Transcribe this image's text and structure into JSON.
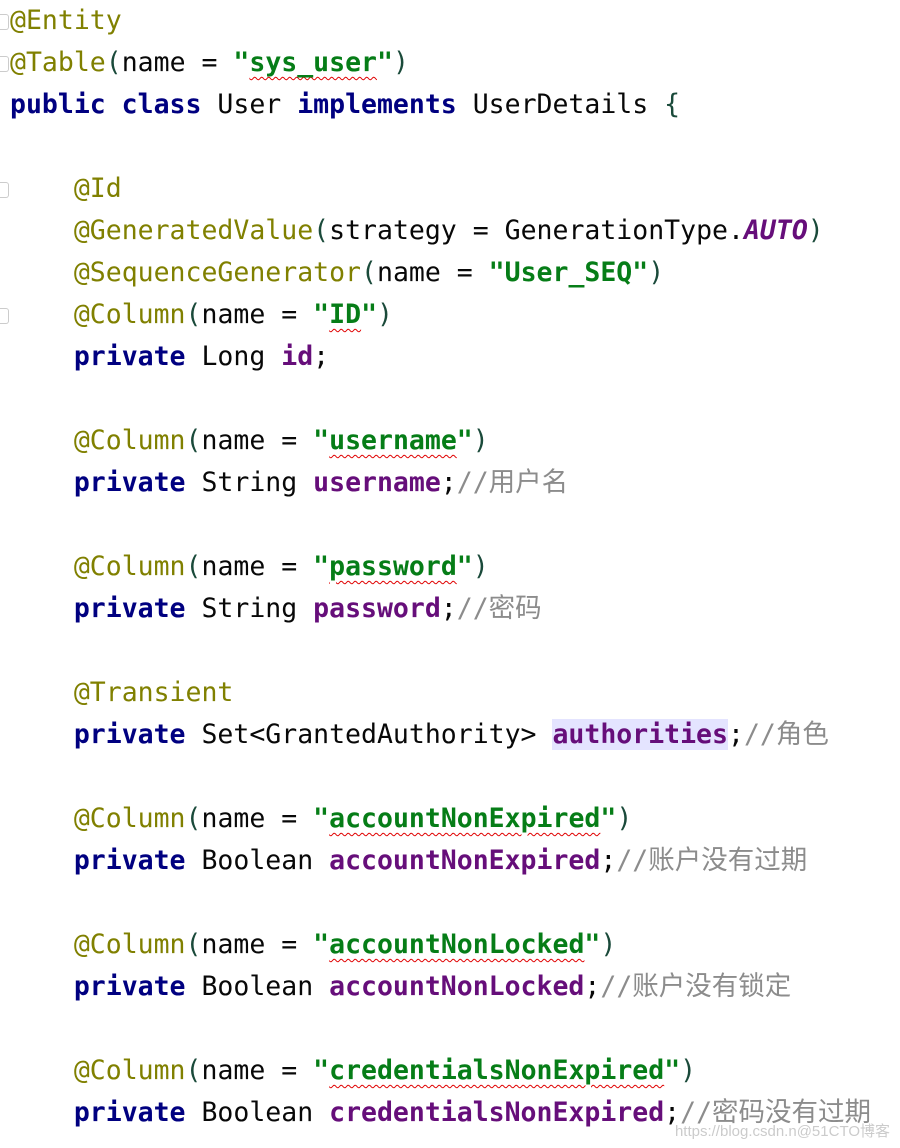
{
  "colors": {
    "annotation": "#808000",
    "keyword": "#000080",
    "string": "#067d17",
    "field": "#660e7a",
    "comment": "#8c8c8c",
    "highlight": "#e4e4ff"
  },
  "lines": [
    [
      [
        "ann",
        "@Entity"
      ]
    ],
    [
      [
        "ann",
        "@Table"
      ],
      [
        "paren",
        "("
      ],
      [
        "plain",
        "name = "
      ],
      [
        "str",
        "\""
      ],
      [
        "str sq",
        "sys_user"
      ],
      [
        "str",
        "\""
      ],
      [
        "paren",
        ")"
      ]
    ],
    [
      [
        "kw",
        "public class "
      ],
      [
        "plain",
        "User "
      ],
      [
        "kw",
        "implements "
      ],
      [
        "plain",
        "UserDetails "
      ],
      [
        "paren",
        "{"
      ]
    ],
    [],
    [
      [
        "plain",
        "    "
      ],
      [
        "ann",
        "@Id"
      ]
    ],
    [
      [
        "plain",
        "    "
      ],
      [
        "ann",
        "@GeneratedValue"
      ],
      [
        "paren",
        "("
      ],
      [
        "plain",
        "strategy = GenerationType."
      ],
      [
        "static",
        "AUTO"
      ],
      [
        "paren",
        ")"
      ]
    ],
    [
      [
        "plain",
        "    "
      ],
      [
        "ann",
        "@SequenceGenerator"
      ],
      [
        "paren",
        "("
      ],
      [
        "plain",
        "name = "
      ],
      [
        "str",
        "\"User_SEQ\""
      ],
      [
        "paren",
        ")"
      ]
    ],
    [
      [
        "plain",
        "    "
      ],
      [
        "ann",
        "@Column"
      ],
      [
        "paren",
        "("
      ],
      [
        "plain",
        "name = "
      ],
      [
        "str",
        "\""
      ],
      [
        "str sq",
        "ID"
      ],
      [
        "str",
        "\""
      ],
      [
        "paren",
        ")"
      ]
    ],
    [
      [
        "plain",
        "    "
      ],
      [
        "kw",
        "private "
      ],
      [
        "plain",
        "Long "
      ],
      [
        "field",
        "id"
      ],
      [
        "plain",
        ";"
      ]
    ],
    [],
    [
      [
        "plain",
        "    "
      ],
      [
        "ann",
        "@Column"
      ],
      [
        "paren",
        "("
      ],
      [
        "plain",
        "name = "
      ],
      [
        "str",
        "\""
      ],
      [
        "str sq",
        "username"
      ],
      [
        "str",
        "\""
      ],
      [
        "paren",
        ")"
      ]
    ],
    [
      [
        "plain",
        "    "
      ],
      [
        "kw",
        "private "
      ],
      [
        "plain",
        "String "
      ],
      [
        "field",
        "username"
      ],
      [
        "plain",
        ";"
      ],
      [
        "comment",
        "//用户名"
      ]
    ],
    [],
    [
      [
        "plain",
        "    "
      ],
      [
        "ann",
        "@Column"
      ],
      [
        "paren",
        "("
      ],
      [
        "plain",
        "name = "
      ],
      [
        "str",
        "\""
      ],
      [
        "str sq",
        "password"
      ],
      [
        "str",
        "\""
      ],
      [
        "paren",
        ")"
      ]
    ],
    [
      [
        "plain",
        "    "
      ],
      [
        "kw",
        "private "
      ],
      [
        "plain",
        "String "
      ],
      [
        "field",
        "password"
      ],
      [
        "plain",
        ";"
      ],
      [
        "comment",
        "//密码"
      ]
    ],
    [],
    [
      [
        "plain",
        "    "
      ],
      [
        "ann",
        "@Transient"
      ]
    ],
    [
      [
        "plain",
        "    "
      ],
      [
        "kw",
        "private "
      ],
      [
        "plain",
        "Set<GrantedAuthority> "
      ],
      [
        "field hl",
        "authorities"
      ],
      [
        "plain",
        ";"
      ],
      [
        "comment",
        "//角色"
      ]
    ],
    [],
    [
      [
        "plain",
        "    "
      ],
      [
        "ann",
        "@Column"
      ],
      [
        "paren",
        "("
      ],
      [
        "plain",
        "name = "
      ],
      [
        "str",
        "\""
      ],
      [
        "str sq",
        "accountNonExpired"
      ],
      [
        "str",
        "\""
      ],
      [
        "paren",
        ")"
      ]
    ],
    [
      [
        "plain",
        "    "
      ],
      [
        "kw",
        "private "
      ],
      [
        "plain",
        "Boolean "
      ],
      [
        "field",
        "accountNonExpired"
      ],
      [
        "plain",
        ";"
      ],
      [
        "comment",
        "//账户没有过期"
      ]
    ],
    [],
    [
      [
        "plain",
        "    "
      ],
      [
        "ann",
        "@Column"
      ],
      [
        "paren",
        "("
      ],
      [
        "plain",
        "name = "
      ],
      [
        "str",
        "\""
      ],
      [
        "str sq",
        "accountNonLocked"
      ],
      [
        "str",
        "\""
      ],
      [
        "paren",
        ")"
      ]
    ],
    [
      [
        "plain",
        "    "
      ],
      [
        "kw",
        "private "
      ],
      [
        "plain",
        "Boolean "
      ],
      [
        "field",
        "accountNonLocked"
      ],
      [
        "plain",
        ";"
      ],
      [
        "comment",
        "//账户没有锁定"
      ]
    ],
    [],
    [
      [
        "plain",
        "    "
      ],
      [
        "ann",
        "@Column"
      ],
      [
        "paren",
        "("
      ],
      [
        "plain",
        "name = "
      ],
      [
        "str",
        "\""
      ],
      [
        "str sq",
        "credentialsNonExpired"
      ],
      [
        "str",
        "\""
      ],
      [
        "paren",
        ")"
      ]
    ],
    [
      [
        "plain",
        "    "
      ],
      [
        "kw",
        "private "
      ],
      [
        "plain",
        "Boolean "
      ],
      [
        "field",
        "credentialsNonExpired"
      ],
      [
        "plain",
        ";"
      ],
      [
        "comment",
        "//密码没有过期"
      ]
    ]
  ],
  "watermark": "https://blog.csdn.n@51CTO博客"
}
